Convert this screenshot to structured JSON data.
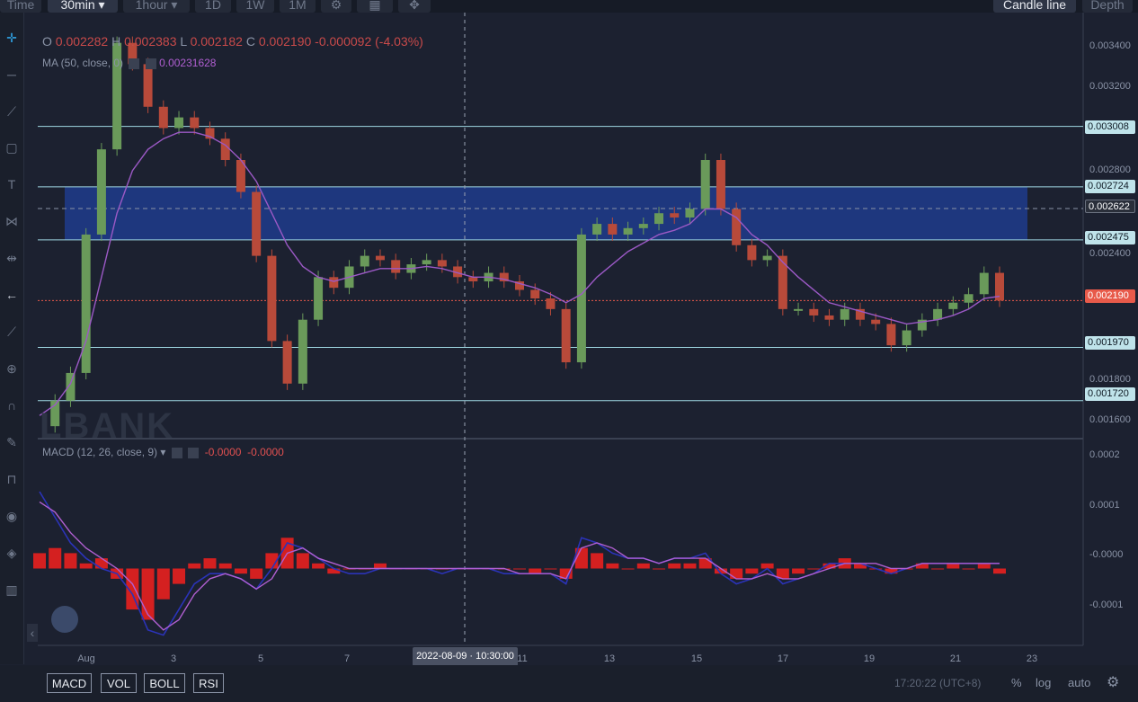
{
  "toolbar": {
    "items": [
      "Time",
      "30min",
      "1hour",
      "1D",
      "1W",
      "1M"
    ],
    "active": "30min",
    "right_buttons": [
      "Candle line",
      "Depth"
    ]
  },
  "legend": {
    "ohlc_label_o": "O",
    "ohlc_o": "0.002282",
    "ohlc_label_h": "H",
    "ohlc_h": "0.002383",
    "ohlc_label_l": "L",
    "ohlc_l": "0.002182",
    "ohlc_label_c": "C",
    "ohlc_c": "0.002190",
    "change": "-0.000092 (-4.03%)",
    "ma_label": "MA (50, close, 0)",
    "ma_value": "0.00231628",
    "macd_label": "MACD (12, 26, close, 9)",
    "macd_val1": "-0.0000",
    "macd_val2": "-0.0000"
  },
  "watermark": "LBANK",
  "chart_data": [
    {
      "type": "line",
      "title": "",
      "x_ticks": [
        "Aug",
        "3",
        "5",
        "7",
        "11",
        "13",
        "15",
        "17",
        "19",
        "21",
        "23"
      ],
      "y_ticks": [
        "0.003400",
        "0.003200",
        "0.002800",
        "0.002400",
        "0.001800",
        "0.001600"
      ],
      "ylim": [
        0.00155,
        0.0035
      ],
      "levels": [
        "0.003008",
        "0.002724",
        "0.002622",
        "0.002475",
        "0.002190",
        "0.001970",
        "0.001720"
      ],
      "zone": {
        "from": 0.002475,
        "to": 0.002724,
        "color": "#1f3b8c"
      },
      "last_price": 0.00219,
      "crosshair_time": "2022-08-09 · 10:30:00",
      "series": [
        {
          "values": [
            0.0016,
            0.00172,
            0.00185,
            0.0025,
            0.0029,
            0.0034,
            0.0033,
            0.0031,
            0.003,
            0.00305,
            0.003,
            0.00295,
            0.00285,
            0.0027,
            0.0024,
            0.002,
            0.0018,
            0.0021,
            0.0023,
            0.00225,
            0.00235,
            0.0024,
            0.00238,
            0.00232,
            0.00236,
            0.00238,
            0.00235,
            0.0023,
            0.00228,
            0.00232,
            0.00228,
            0.00224,
            0.0022,
            0.00215,
            0.0019,
            0.0025,
            0.00255,
            0.0025,
            0.00253,
            0.00255,
            0.0026,
            0.00258,
            0.00262,
            0.00285,
            0.00262,
            0.00245,
            0.00238,
            0.0024,
            0.00215,
            0.00215,
            0.00212,
            0.0021,
            0.00215,
            0.0021,
            0.00208,
            0.00198,
            0.00205,
            0.0021,
            0.00215,
            0.00218,
            0.00222,
            0.00232,
            0.00219
          ],
          "color": "#e0e6ee"
        },
        {
          "values": [
            0.00165,
            0.0017,
            0.0018,
            0.002,
            0.0023,
            0.0026,
            0.0028,
            0.0029,
            0.00295,
            0.00298,
            0.00298,
            0.00296,
            0.00292,
            0.00285,
            0.00275,
            0.0026,
            0.00245,
            0.00235,
            0.0023,
            0.00228,
            0.0023,
            0.00232,
            0.00234,
            0.00234,
            0.00234,
            0.00235,
            0.00234,
            0.00232,
            0.0023,
            0.0023,
            0.00229,
            0.00227,
            0.00225,
            0.00222,
            0.00218,
            0.00222,
            0.0023,
            0.00236,
            0.00242,
            0.00246,
            0.0025,
            0.00252,
            0.00255,
            0.00262,
            0.00262,
            0.00258,
            0.0025,
            0.00245,
            0.00237,
            0.0023,
            0.00224,
            0.00218,
            0.00216,
            0.00214,
            0.00212,
            0.0021,
            0.00208,
            0.00209,
            0.0021,
            0.00212,
            0.00215,
            0.0022,
            0.00221
          ],
          "color": "#9b59c5"
        }
      ]
    },
    {
      "type": "bar",
      "title": "",
      "y_ticks": [
        "0.0002",
        "0.0001",
        "-0.0000",
        "-0.0001"
      ],
      "ylim": [
        -0.00015,
        0.00025
      ],
      "series": [
        {
          "values": [
            3e-05,
            4e-05,
            3e-05,
            1e-05,
            2e-05,
            -2e-05,
            -8e-05,
            -0.0001,
            -6e-05,
            -3e-05,
            1e-05,
            2e-05,
            1e-05,
            -1e-05,
            -2e-05,
            3e-05,
            6e-05,
            3e-05,
            1e-05,
            -1e-05,
            -0.0,
            0.0,
            1e-05,
            -0.0,
            0.0,
            0.0,
            -0.0,
            0.0,
            0.0,
            -0.0,
            0.0,
            -0.0,
            -1e-05,
            -0.0,
            -2e-05,
            4e-05,
            3e-05,
            1e-05,
            0.0,
            1e-05,
            0.0,
            1e-05,
            1e-05,
            2e-05,
            -1e-05,
            -2e-05,
            -1e-05,
            1e-05,
            -2e-05,
            -1e-05,
            0.0,
            1e-05,
            2e-05,
            1e-05,
            0.0,
            -1e-05,
            0.0,
            1e-05,
            0.0,
            1e-05,
            0.0,
            1e-05,
            -1e-05
          ],
          "color": "#d42020"
        },
        {
          "values": [
            0.00015,
            0.0001,
            5e-05,
            2e-05,
            0.0,
            -1e-05,
            -5e-05,
            -0.00012,
            -0.00013,
            -8e-05,
            -3e-05,
            -1e-05,
            -1e-05,
            -2e-05,
            -4e-05,
            0.0,
            5e-05,
            4e-05,
            2e-05,
            0.0,
            -1e-05,
            -1e-05,
            0.0,
            0.0,
            0.0,
            0.0,
            -1e-05,
            -0.0,
            0.0,
            -0.0,
            -1e-05,
            -1e-05,
            -1e-05,
            -1e-05,
            -3e-05,
            6e-05,
            5e-05,
            3e-05,
            2e-05,
            2e-05,
            1e-05,
            2e-05,
            2e-05,
            3e-05,
            -1e-05,
            -3e-05,
            -2e-05,
            -0.0,
            -3e-05,
            -2e-05,
            -1e-05,
            1e-05,
            1e-05,
            1e-05,
            0.0,
            -1e-05,
            -0.0,
            1e-05,
            1e-05,
            1e-05,
            1e-05,
            1e-05,
            1e-05
          ],
          "color": "#2b33b8"
        },
        {
          "values": [
            0.00013,
            0.00011,
            7e-05,
            4e-05,
            2e-05,
            0.0,
            -3e-05,
            -9e-05,
            -0.00012,
            -0.0001,
            -5e-05,
            -2e-05,
            -1e-05,
            -2e-05,
            -4e-05,
            -2e-05,
            3e-05,
            4e-05,
            2e-05,
            1e-05,
            0.0,
            -0.0,
            0.0,
            0.0,
            0.0,
            0.0,
            -0.0,
            -0.0,
            0.0,
            -0.0,
            -0.0,
            -1e-05,
            -1e-05,
            -1e-05,
            -2e-05,
            4e-05,
            5e-05,
            4e-05,
            2e-05,
            2e-05,
            1e-05,
            2e-05,
            2e-05,
            2e-05,
            0.0,
            -2e-05,
            -2e-05,
            -1e-05,
            -2e-05,
            -2e-05,
            -1e-05,
            0.0,
            1e-05,
            1e-05,
            1e-05,
            -0.0,
            -0.0,
            1e-05,
            1e-05,
            1e-05,
            1e-05,
            1e-05,
            1e-05
          ],
          "color": "#b05fd1"
        }
      ]
    }
  ],
  "bottom": {
    "indicators": [
      "MACD",
      "VOL",
      "BOLL",
      "RSI"
    ],
    "clock": "17:20:22 (UTC+8)",
    "percent": "%",
    "log": "log",
    "auto": "auto"
  },
  "colors": {
    "background": "#1c2130",
    "grid": "#262c3b",
    "level_line": "#9fd7e2",
    "zone": "#1f3b8c",
    "up": "#6a9a5a",
    "down": "#b84a3a",
    "ma": "#9b59c5",
    "macd_hist": "#d42020",
    "macd_line": "#2b33b8",
    "signal_line": "#b05fd1",
    "price_tag": "#e85a4a"
  },
  "icons": [
    "crosshair-icon",
    "line-icon",
    "trend-icon",
    "rect-icon",
    "text-icon",
    "pattern-icon",
    "measure-icon",
    "back-arrow-icon",
    "ruler-icon",
    "zoom-icon",
    "magnet-icon",
    "brush-icon",
    "lock-icon",
    "eye-icon",
    "layers-icon",
    "trash-icon",
    "gear-icon"
  ]
}
